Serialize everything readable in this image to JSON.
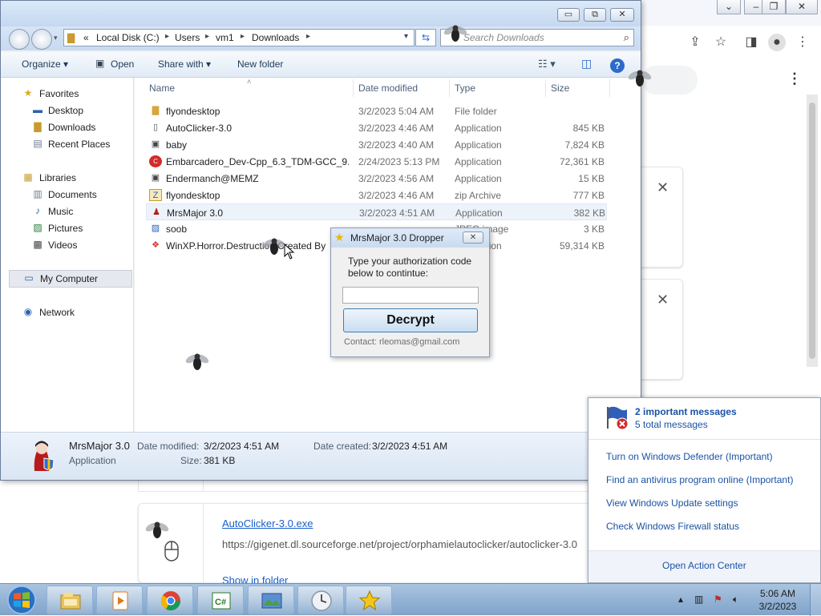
{
  "explorer": {
    "window_buttons": {
      "minimize": "▭",
      "restore": "⧉",
      "close": "✕"
    },
    "address": {
      "prefix": "«",
      "crumbs": [
        "Local Disk (C:)",
        "Users",
        "vm1",
        "Downloads"
      ]
    },
    "search_placeholder": "Search Downloads",
    "toolbar": {
      "organize": "Organize ▾",
      "open": "Open",
      "share_with": "Share with ▾",
      "new_folder": "New folder"
    },
    "nav": {
      "favorites": "Favorites",
      "desktop": "Desktop",
      "downloads": "Downloads",
      "recent_places": "Recent Places",
      "libraries": "Libraries",
      "documents": "Documents",
      "music": "Music",
      "pictures": "Pictures",
      "videos": "Videos",
      "my_computer": "My Computer",
      "network": "Network"
    },
    "columns": {
      "name": "Name",
      "date": "Date modified",
      "type": "Type",
      "size": "Size"
    },
    "files": [
      {
        "name": "flyondesktop",
        "date": "3/2/2023 5:04 AM",
        "type": "File folder",
        "size": ""
      },
      {
        "name": "AutoClicker-3.0",
        "date": "3/2/2023 4:46 AM",
        "type": "Application",
        "size": "845 KB"
      },
      {
        "name": "baby",
        "date": "3/2/2023 4:40 AM",
        "type": "Application",
        "size": "7,824 KB"
      },
      {
        "name": "Embarcadero_Dev-Cpp_6.3_TDM-GCC_9....",
        "date": "2/24/2023 5:13 PM",
        "type": "Application",
        "size": "72,361 KB"
      },
      {
        "name": "Endermanch@MEMZ",
        "date": "3/2/2023 4:56 AM",
        "type": "Application",
        "size": "15 KB"
      },
      {
        "name": "flyondesktop",
        "date": "3/2/2023 4:46 AM",
        "type": "zip Archive",
        "size": "777 KB"
      },
      {
        "name": "MrsMajor 3.0",
        "date": "3/2/2023 4:51 AM",
        "type": "Application",
        "size": "382 KB"
      },
      {
        "name": "soob",
        "date": "",
        "type": "JPEG image",
        "size": "3 KB"
      },
      {
        "name": "WinXP.Horror.Destruction Created By",
        "date": "",
        "type": "Application",
        "size": "59,314 KB"
      }
    ],
    "details": {
      "name": "MrsMajor 3.0",
      "kind": "Application",
      "modified_label": "Date modified:",
      "modified": "3/2/2023 4:51 AM",
      "created_label": "Date created:",
      "created": "3/2/2023 4:51 AM",
      "size_label": "Size:",
      "size": "381 KB"
    }
  },
  "dropper": {
    "title": "MrsMajor 3.0 Dropper",
    "message": "Type your authorization code below to contintue:",
    "code_value": "",
    "button": "Decrypt",
    "contact": "Contact: rleomas@gmail.com"
  },
  "browser": {
    "download": {
      "filename": "AutoClicker-3.0.exe",
      "url": "https://gigenet.dl.sourceforge.net/project/orphamielautoclicker/autoclicker-3.0",
      "show_in_folder": "Show in folder"
    }
  },
  "action_center": {
    "important": "2 important messages",
    "total": "5 total messages",
    "links": [
      "Turn on Windows Defender (Important)",
      "Find an antivirus program online (Important)",
      "View Windows Update settings",
      "Check Windows Firewall status"
    ],
    "open": "Open Action Center"
  },
  "taskbar": {
    "clock_time": "5:06 AM",
    "clock_date": "3/2/2023"
  },
  "colors": {
    "link_blue": "#1a52a5",
    "selection": "#edf3fa",
    "taskbar": "#8fb0d4"
  }
}
